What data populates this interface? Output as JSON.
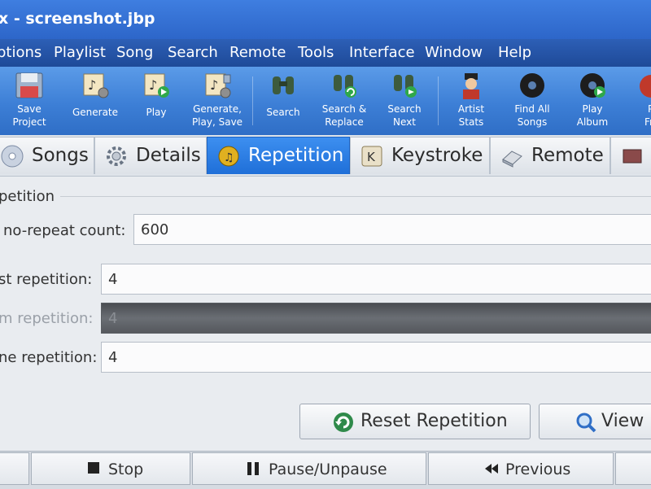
{
  "window": {
    "title": "x - screenshot.jbp"
  },
  "menu": [
    "ptions",
    "Playlist",
    "Song",
    "Search",
    "Remote",
    "Tools",
    "Interface",
    "Window",
    "Help"
  ],
  "toolbar": {
    "save_project": [
      "Save",
      "Project"
    ],
    "generate": "Generate",
    "play": "Play",
    "generate_play_save": [
      "Generate,",
      "Play, Save"
    ],
    "search": "Search",
    "search_replace": [
      "Search &",
      "Replace"
    ],
    "search_next": [
      "Search",
      "Next"
    ],
    "artist_stats": [
      "Artist",
      "Stats"
    ],
    "find_all_songs": [
      "Find All",
      "Songs"
    ],
    "play_album": [
      "Play",
      "Album"
    ],
    "partial": [
      "P",
      "Fr"
    ]
  },
  "tabs": {
    "songs": "Songs",
    "details": "Details",
    "repetition": "Repetition",
    "keystroke": "Keystroke",
    "remote": "Remote"
  },
  "repetition": {
    "group_title": "petition",
    "no_repeat_label": "no-repeat count:",
    "no_repeat_value": "600",
    "artist_label": "st repetition:",
    "artist_value": "4",
    "album_label": "m repetition:",
    "album_value": "4",
    "genre_label": "ne repetition:",
    "genre_value": "4",
    "reset_button": "Reset Repetition",
    "view_button": "View I"
  },
  "controls": {
    "stop": "Stop",
    "pause": "Pause/Unpause",
    "previous": "Previous"
  },
  "colors": {
    "titlebar": "#2d66c9",
    "menubar": "#1e4a98",
    "toolbar": "#3d7fd6",
    "active_tab": "#1f6fd8"
  }
}
